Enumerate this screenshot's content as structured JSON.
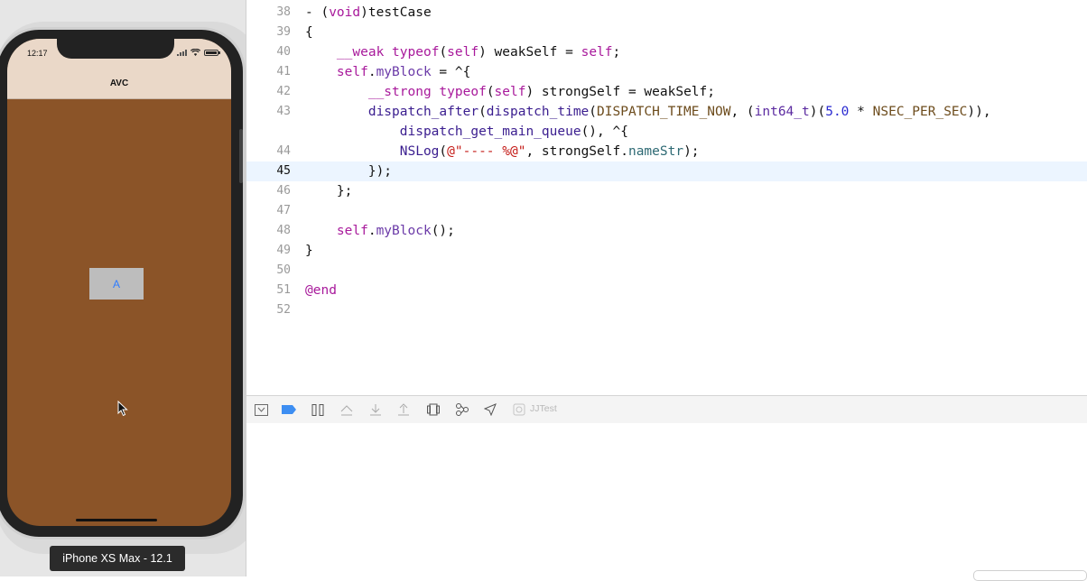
{
  "simulator": {
    "status_time": "12:17",
    "nav_title": "AVC",
    "button_label": "A",
    "device_label": "iPhone XS Max - 12.1"
  },
  "editor": {
    "current_line": "45",
    "lines": [
      {
        "n": "38",
        "html": "- (<span class=\"kw\">void</span>)testCase"
      },
      {
        "n": "39",
        "html": "{"
      },
      {
        "n": "40",
        "html": "    <span class=\"kw\">__weak</span> <span class=\"kw\">typeof</span>(<span class=\"kw\">self</span>) weakSelf = <span class=\"kw\">self</span>;"
      },
      {
        "n": "41",
        "html": "    <span class=\"kw\">self</span>.<span class=\"prop\">myBlock</span> = ^{"
      },
      {
        "n": "42",
        "html": "        <span class=\"kw\">__strong</span> <span class=\"kw\">typeof</span>(<span class=\"kw\">self</span>) strongSelf = weakSelf;"
      },
      {
        "n": "43",
        "html": "        <span class=\"call\">dispatch_after</span>(<span class=\"call\">dispatch_time</span>(<span class=\"mac\">DISPATCH_TIME_NOW</span>, (<span class=\"typ\">int64_t</span>)(<span class=\"num\">5.0</span> * <span class=\"mac\">NSEC_PER_SEC</span>)),"
      },
      {
        "n": "",
        "html": "            <span class=\"call\">dispatch_get_main_queue</span>(), ^{"
      },
      {
        "n": "44",
        "html": "            <span class=\"call\">NSLog</span>(<span class=\"str\">@\"---- %@\"</span>, strongSelf.<span class=\"nstr\">nameStr</span>);"
      },
      {
        "n": "45",
        "html": "        });"
      },
      {
        "n": "46",
        "html": "    };"
      },
      {
        "n": "47",
        "html": ""
      },
      {
        "n": "48",
        "html": "    <span class=\"kw\">self</span>.<span class=\"prop\">myBlock</span>();"
      },
      {
        "n": "49",
        "html": "}"
      },
      {
        "n": "50",
        "html": ""
      },
      {
        "n": "51",
        "html": "<span class=\"kw\">@end</span>"
      },
      {
        "n": "52",
        "html": ""
      }
    ]
  },
  "debug_bar": {
    "target": "JJTest",
    "icons": [
      "hide-console-icon",
      "breakpoint-icon",
      "pause-icon",
      "step-over-icon",
      "step-into-icon",
      "step-out-icon",
      "view-debugger-icon",
      "memory-graph-icon",
      "location-icon",
      "scheme-icon"
    ]
  },
  "colors": {
    "simulator_background": "#8b5428",
    "nav_bar": "#ead8c8",
    "button_text": "#2f7dff",
    "current_line_highlight": "#ecf5ff"
  }
}
